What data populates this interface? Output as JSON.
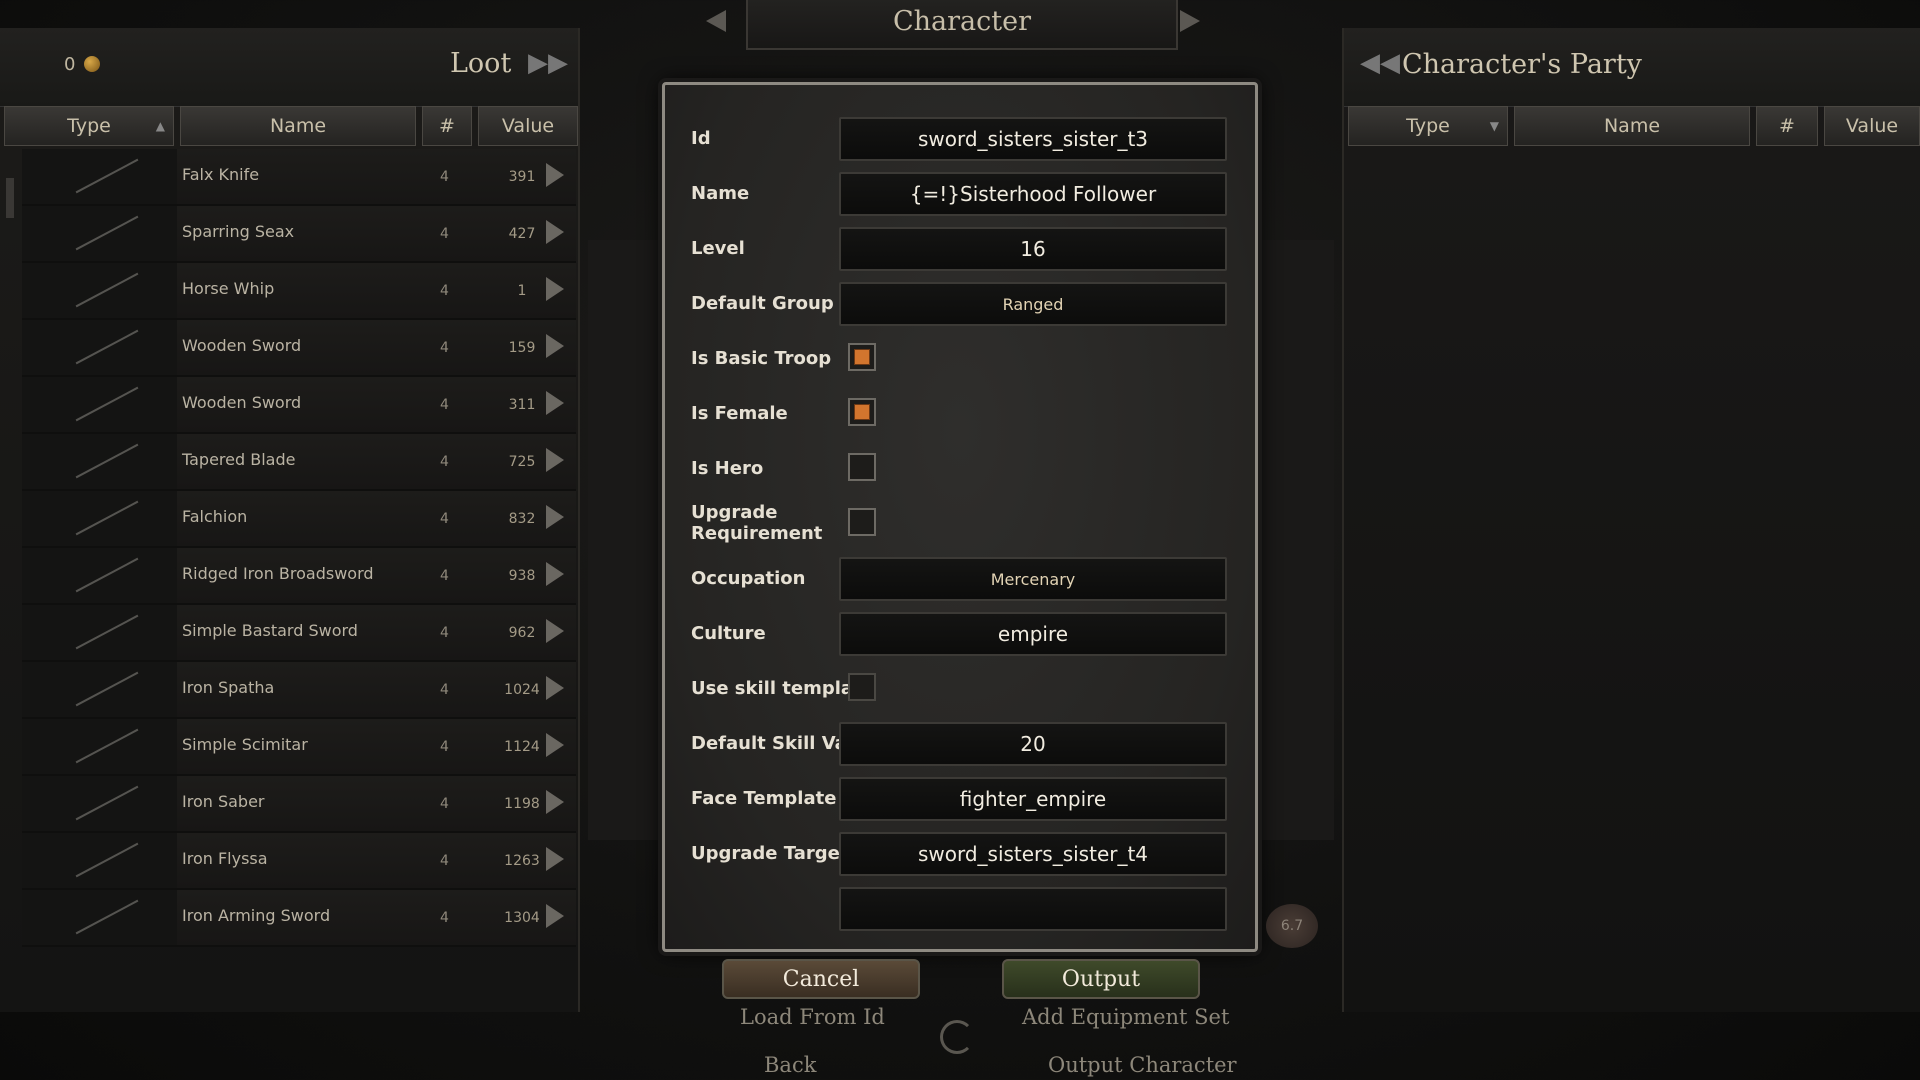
{
  "top": {
    "title": "Character"
  },
  "loot": {
    "gold": "0",
    "title": "Loot",
    "columns": {
      "type": "Type",
      "name": "Name",
      "count": "#",
      "value": "Value"
    },
    "items": [
      {
        "name": "Falx Knife",
        "count": "4",
        "value": "391"
      },
      {
        "name": "Sparring Seax",
        "count": "4",
        "value": "427"
      },
      {
        "name": "Horse Whip",
        "count": "4",
        "value": "1"
      },
      {
        "name": "Wooden Sword",
        "count": "4",
        "value": "159"
      },
      {
        "name": "Wooden Sword",
        "count": "4",
        "value": "311"
      },
      {
        "name": "Tapered Blade",
        "count": "4",
        "value": "725"
      },
      {
        "name": "Falchion",
        "count": "4",
        "value": "832"
      },
      {
        "name": "Ridged Iron Broadsword",
        "count": "4",
        "value": "938"
      },
      {
        "name": "Simple Bastard Sword",
        "count": "4",
        "value": "962"
      },
      {
        "name": "Iron Spatha",
        "count": "4",
        "value": "1024"
      },
      {
        "name": "Simple Scimitar",
        "count": "4",
        "value": "1124"
      },
      {
        "name": "Iron Saber",
        "count": "4",
        "value": "1198"
      },
      {
        "name": "Iron Flyssa",
        "count": "4",
        "value": "1263"
      },
      {
        "name": "Iron Arming Sword",
        "count": "4",
        "value": "1304"
      }
    ]
  },
  "party": {
    "title": "Character's Party",
    "columns": {
      "type": "Type",
      "name": "Name",
      "count": "#",
      "value": "Value"
    }
  },
  "form": {
    "id": {
      "label": "Id",
      "value": "sword_sisters_sister_t3"
    },
    "name": {
      "label": "Name",
      "value": "{=!}Sisterhood Follower"
    },
    "level": {
      "label": "Level",
      "value": "16"
    },
    "default_group": {
      "label": "Default Group",
      "value": "Ranged"
    },
    "is_basic_troop": {
      "label": "Is Basic Troop",
      "checked": true
    },
    "is_female": {
      "label": "Is Female",
      "checked": true
    },
    "is_hero": {
      "label": "Is Hero",
      "checked": false
    },
    "upgrade_requirement": {
      "label": "Upgrade Requirement",
      "checked": false
    },
    "occupation": {
      "label": "Occupation",
      "value": "Mercenary"
    },
    "culture": {
      "label": "Culture",
      "value": "empire"
    },
    "use_skill_template": {
      "label": "Use skill template",
      "checked": false
    },
    "default_skill_value": {
      "label": "Default Skill Value",
      "value": "20"
    },
    "face_template": {
      "label": "Face Template",
      "value": "fighter_empire"
    },
    "upgrade_targets": {
      "label": "Upgrade Targets",
      "value": "sword_sisters_sister_t4",
      "value2": ""
    }
  },
  "buttons": {
    "cancel": "Cancel",
    "output": "Output",
    "load_from_id": "Load From Id",
    "add_equipment_set": "Add Equipment Set",
    "back": "Back",
    "output_character": "Output Character"
  },
  "weight": "6.7",
  "colors": {
    "checkbox_fill": "#d2752e",
    "dialog_border": "#8e8a82"
  }
}
